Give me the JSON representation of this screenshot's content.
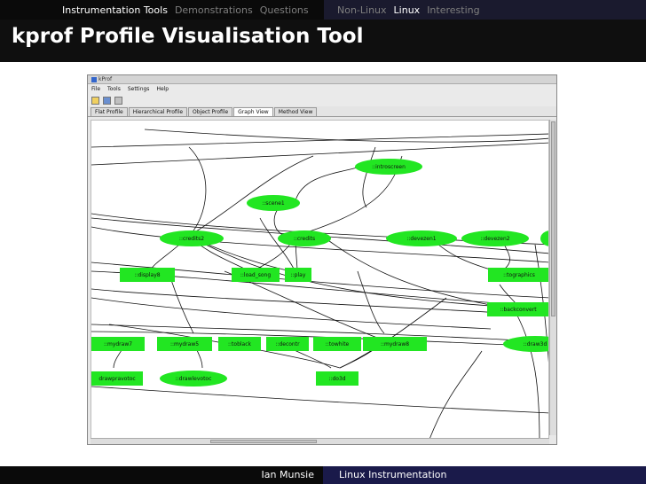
{
  "slide": {
    "nav_left": [
      "Instrumentation Tools",
      "Demonstrations",
      "Questions"
    ],
    "nav_right": [
      "Non-Linux",
      "Linux",
      "Interesting"
    ],
    "active_nav": "Linux",
    "title": "kprof Profile Visualisation Tool",
    "footer_author": "Ian Munsie",
    "footer_title": "Linux Instrumentation"
  },
  "window": {
    "title": "kProf",
    "menu": [
      "File",
      "Tools",
      "Settings",
      "Help"
    ],
    "tabs": [
      "Flat Profile",
      "Hierarchical Profile",
      "Object Profile",
      "Graph View",
      "Method View"
    ],
    "active_tab": "Graph View"
  },
  "graph": {
    "node_color": "#22e622",
    "nodes": [
      {
        "id": "introscreen",
        "label": "::introscreen"
      },
      {
        "id": "scene1",
        "label": "::scene1"
      },
      {
        "id": "credits2",
        "label": "::credits2"
      },
      {
        "id": "credits",
        "label": "::credits"
      },
      {
        "id": "devezen1",
        "label": "::devezen1"
      },
      {
        "id": "devezen2",
        "label": "::devezen2"
      },
      {
        "id": "display8",
        "label": "::display8"
      },
      {
        "id": "load_song",
        "label": "::load_song"
      },
      {
        "id": "play",
        "label": "::play"
      },
      {
        "id": "tographics",
        "label": "::tographics"
      },
      {
        "id": "backconvert",
        "label": "::backconvert"
      },
      {
        "id": "mydraw7",
        "label": "::mydraw7"
      },
      {
        "id": "mydraw5",
        "label": "::mydraw5"
      },
      {
        "id": "toblack",
        "label": "::toblack"
      },
      {
        "id": "decontr",
        "label": "::decontr"
      },
      {
        "id": "towhite",
        "label": "::towhite"
      },
      {
        "id": "mydraw8",
        "label": "::mydraw8"
      },
      {
        "id": "draw3d",
        "label": "::draw3d"
      },
      {
        "id": "drawpravotoc",
        "label": "drawpravotoc"
      },
      {
        "id": "drawlevotoc",
        "label": "::drawlevotoc"
      },
      {
        "id": "do3d",
        "label": "::do3d"
      }
    ]
  }
}
